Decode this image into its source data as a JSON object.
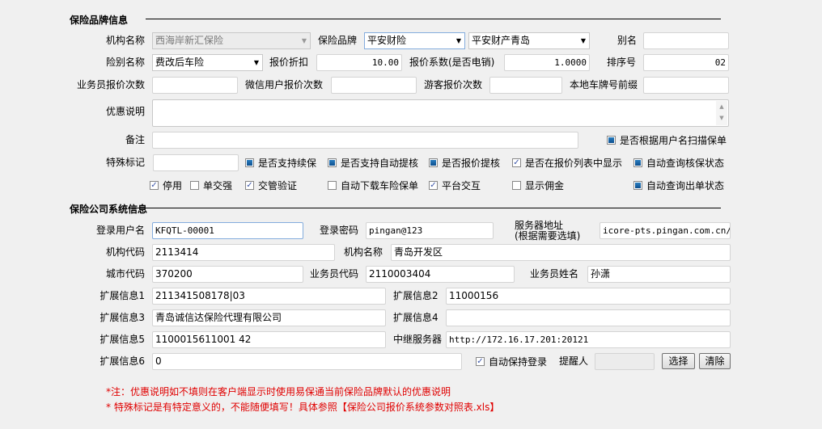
{
  "brand_section": {
    "title": "保险品牌信息",
    "org_name_label": "机构名称",
    "org_name_value": "西海岸新汇保险",
    "brand_label": "保险品牌",
    "brand_value": "平安财险",
    "brand_branch_value": "平安财产青岛",
    "alias_label": "别名",
    "alias_value": "",
    "insurance_type_label": "险别名称",
    "insurance_type_value": "费改后车险",
    "discount_label": "报价折扣",
    "discount_value": "10.00",
    "coef_label": "报价系数(是否电销)",
    "coef_value": "1.0000",
    "sort_label": "排序号",
    "sort_value": "02",
    "agent_count_label": "业务员报价次数",
    "agent_count_value": "",
    "wechat_count_label": "微信用户报价次数",
    "wechat_count_value": "",
    "guest_count_label": "游客报价次数",
    "guest_count_value": "",
    "plate_prefix_label": "本地车牌号前缀",
    "plate_prefix_value": "",
    "promo_label": "优惠说明",
    "promo_value": "",
    "remark_label": "备注",
    "remark_value": "",
    "special_label": "特殊标记",
    "special_value": "",
    "checkboxes": [
      {
        "label": "是否根据用户名扫描保单",
        "state": "indeterminate"
      },
      {
        "label": "是否支持续保",
        "state": "indeterminate"
      },
      {
        "label": "是否支持自动提核",
        "state": "indeterminate"
      },
      {
        "label": "是否报价提核",
        "state": "indeterminate"
      },
      {
        "label": "是否在报价列表中显示",
        "state": "checked"
      },
      {
        "label": "自动查询核保状态",
        "state": "indeterminate"
      },
      {
        "label": "停用",
        "state": "checked"
      },
      {
        "label": "单交强",
        "state": "unchecked"
      },
      {
        "label": "交管验证",
        "state": "checked"
      },
      {
        "label": "自动下载车险保单",
        "state": "unchecked"
      },
      {
        "label": "平台交互",
        "state": "checked"
      },
      {
        "label": "显示佣金",
        "state": "unchecked"
      },
      {
        "label": "自动查询出单状态",
        "state": "indeterminate"
      }
    ]
  },
  "system_section": {
    "title": "保险公司系统信息",
    "login_user_label": "登录用户名",
    "login_user_value": "KFQTL-00001",
    "login_pwd_label": "登录密码",
    "login_pwd_value": "pingan@123",
    "server_label": "服务器地址",
    "server_sublabel": "(根据需要选填)",
    "server_value": "icore-pts.pingan.com.cn/ebusiness",
    "org_code_label": "机构代码",
    "org_code_value": "2113414",
    "org_name_label": "机构名称",
    "org_name_value": "青岛开发区",
    "city_code_label": "城市代码",
    "city_code_value": "370200",
    "agent_code_label": "业务员代码",
    "agent_code_value": "2110003404",
    "agent_name_label": "业务员姓名",
    "agent_name_value": "孙潇",
    "ext1_label": "扩展信息1",
    "ext1_value": "211341508178|03",
    "ext2_label": "扩展信息2",
    "ext2_value": "11000156",
    "ext3_label": "扩展信息3",
    "ext3_value": "青岛诚信达保险代理有限公司",
    "ext4_label": "扩展信息4",
    "ext4_value": "",
    "ext5_label": "扩展信息5",
    "ext5_value": "1100015611001 42",
    "relay_label": "中继服务器",
    "relay_value": "http://172.16.17.201:20121",
    "ext6_label": "扩展信息6",
    "ext6_value": "0",
    "keep_login_label": "自动保持登录",
    "keep_login_state": "checked",
    "reminder_label": "提醒人",
    "reminder_value": "",
    "select_button": "选择",
    "clear_button": "清除"
  },
  "notes": [
    "*注：优惠说明如不填则在客户端显示时使用易保通当前保险品牌默认的优惠说明",
    "* 特殊标记是有特定意义的，不能随便填写！具体参照【保险公司报价系统参数对照表.xls】"
  ]
}
